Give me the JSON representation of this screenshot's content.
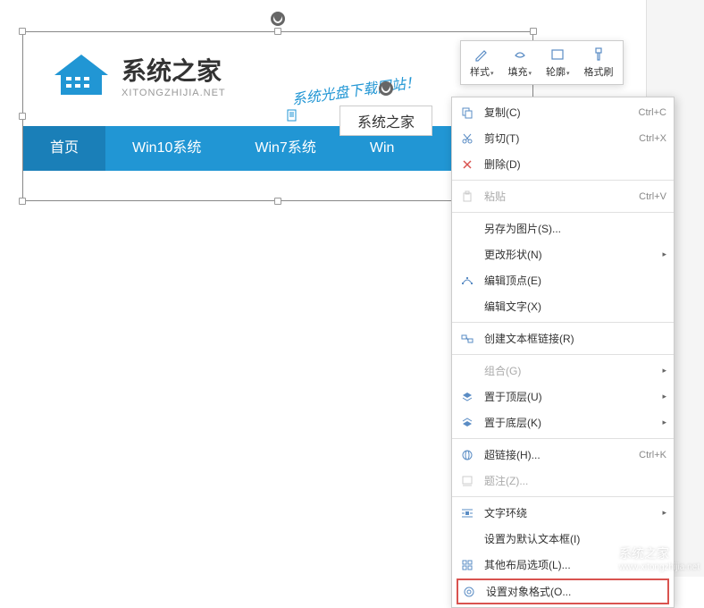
{
  "website": {
    "logo_text_cn": "系统之家",
    "logo_text_en": "XITONGZHIJIA.NET",
    "script_text": "系统光盘下载网站！",
    "nav": {
      "home": "首页",
      "win10": "Win10系统",
      "win7": "Win7系统",
      "win_partial": "Win"
    }
  },
  "textbox": {
    "content": "系统之家"
  },
  "toolbar": {
    "style": "样式",
    "fill": "填充",
    "outline": "轮廓",
    "format_painter": "格式刷"
  },
  "context_menu": {
    "copy": {
      "label": "复制(C)",
      "shortcut": "Ctrl+C"
    },
    "cut": {
      "label": "剪切(T)",
      "shortcut": "Ctrl+X"
    },
    "delete": {
      "label": "删除(D)"
    },
    "paste": {
      "label": "粘贴",
      "shortcut": "Ctrl+V"
    },
    "save_as_image": {
      "label": "另存为图片(S)..."
    },
    "change_shape": {
      "label": "更改形状(N)"
    },
    "edit_vertex": {
      "label": "编辑顶点(E)"
    },
    "edit_text": {
      "label": "编辑文字(X)"
    },
    "create_textbox_link": {
      "label": "创建文本框链接(R)"
    },
    "group": {
      "label": "组合(G)"
    },
    "bring_to_top": {
      "label": "置于顶层(U)"
    },
    "bring_to_bottom": {
      "label": "置于底层(K)"
    },
    "hyperlink": {
      "label": "超链接(H)...",
      "shortcut": "Ctrl+K"
    },
    "caption": {
      "label": "题注(Z)..."
    },
    "text_wrap": {
      "label": "文字环绕"
    },
    "set_default_textbox": {
      "label": "设置为默认文本框(I)"
    },
    "other_layout": {
      "label": "其他布局选项(L)..."
    },
    "object_format": {
      "label": "设置对象格式(O..."
    }
  },
  "watermark": {
    "text": "系统之家",
    "url": "www.xitongzhijia.net"
  }
}
